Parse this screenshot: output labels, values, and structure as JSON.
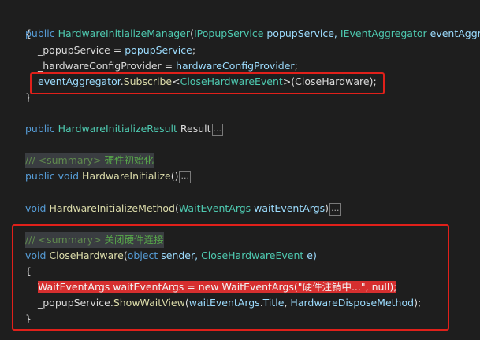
{
  "lines": {
    "l1": {
      "kw": "public",
      "cls": "HardwareInitializeManager",
      "rest1": "(",
      "t1": "IPopupService",
      "p1": " popupService, ",
      "t2": "IEventAggregator",
      "p2": " eventAggreg"
    },
    "l2": {
      "text": "{"
    },
    "l3": {
      "a": "_popupService",
      "b": " = ",
      "c": "popupService",
      "d": ";"
    },
    "l4": {
      "a": "_hardwareConfigProvider",
      "b": " = ",
      "c": "hardwareConfigProvider",
      "d": ";"
    },
    "l5": {
      "a": "eventAggregator",
      "b": ".",
      "c": "Subscribe",
      "d": "<",
      "e": "CloseHardwareEvent",
      "f": ">(CloseHardware);"
    },
    "l6": {
      "text": "}"
    },
    "l7": {
      "kw": "public",
      "ty": "HardwareInitializeResult",
      "name": "Result",
      "collapsed": "..."
    },
    "l8": {
      "slashes": "///",
      "tag": "<summary>",
      "txt": "硬件初始化"
    },
    "l9": {
      "kw1": "public",
      "kw2": "void",
      "name": "HardwareInitialize",
      "paren": "()",
      "collapsed": "..."
    },
    "l10": {
      "kw": "void",
      "name": "HardwareInitializeMethod",
      "paren1": "(",
      "ty": "WaitEventArgs",
      "param": " waitEventArgs",
      "paren2": ")",
      "collapsed": "..."
    },
    "l11": {
      "slashes": "///",
      "tag": "<summary>",
      "txt": "关闭硬件连接"
    },
    "l12": {
      "kw": "void",
      "name": "CloseHardware",
      "p1": "(",
      "kw2": "object",
      "p2": " sender, ",
      "ty": "CloseHardwareEvent",
      "p3": " e)"
    },
    "l13": {
      "text": "{"
    },
    "l14": {
      "text": "WaitEventArgs waitEventArgs = new WaitEventArgs(\"硬件注销中...\", null);"
    },
    "l15": {
      "a": "_popupService",
      "b": ".",
      "c": "ShowWaitView",
      "d": "(",
      "e": "waitEventArgs",
      "f": ".",
      "g": "Title",
      "h": ", ",
      "i": "HardwareDisposeMethod",
      "j": ");"
    },
    "l16": {
      "text": "}"
    }
  },
  "colors": {
    "keyword": "#569cd6",
    "type": "#4ec9b0",
    "method": "#dcdcaa",
    "comment": "#57a64a",
    "highlight_box": "#e0201a"
  }
}
